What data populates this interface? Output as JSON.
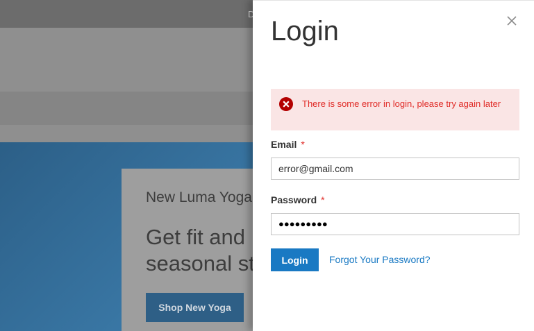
{
  "background": {
    "topbar_text": "D",
    "hero": {
      "faint_text": "",
      "subtitle": "New Luma Yoga",
      "title_line1": "Get fit and",
      "title_line2": "seasonal st",
      "button_label": "Shop New Yoga"
    }
  },
  "modal": {
    "title": "Login",
    "close_icon": "close-icon",
    "error": {
      "icon": "error-circle-icon",
      "message": "There is some error in login, please try again later"
    },
    "email": {
      "label": "Email",
      "required_mark": "*",
      "value": "error@gmail.com"
    },
    "password": {
      "label": "Password",
      "required_mark": "*",
      "masked_value": "●●●●●●●●●"
    },
    "login_button": "Login",
    "forgot_link": "Forgot Your Password?"
  },
  "colors": {
    "accent": "#1979c3",
    "error_text": "#e02b27",
    "error_bg": "#fae5e5"
  }
}
